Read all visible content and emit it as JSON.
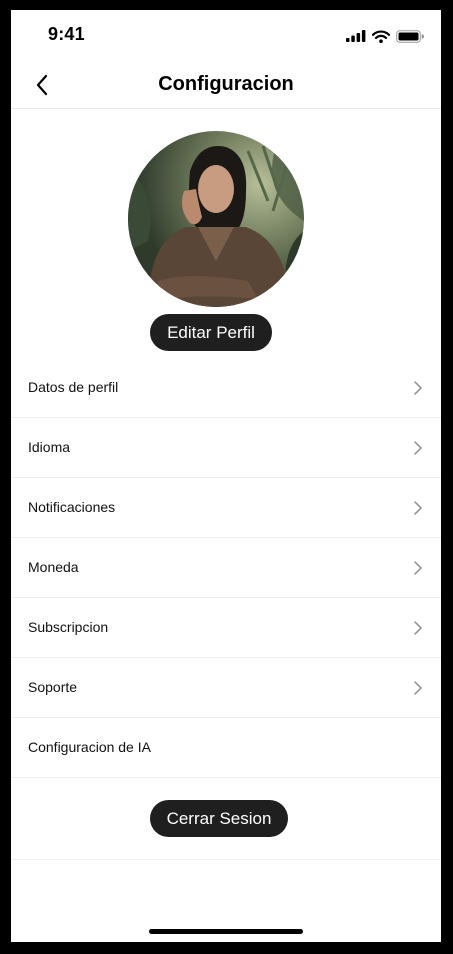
{
  "status_bar": {
    "time": "9:41"
  },
  "header": {
    "title": "Configuracion"
  },
  "profile": {
    "edit_label": "Editar Perfil"
  },
  "menu": {
    "items": [
      {
        "label": "Datos de perfil"
      },
      {
        "label": "Idioma"
      },
      {
        "label": "Notificaciones"
      },
      {
        "label": "Moneda"
      },
      {
        "label": "Subscripcion"
      },
      {
        "label": "Soporte"
      },
      {
        "label": "Configuracion de IA"
      }
    ]
  },
  "logout": {
    "label": "Cerrar Sesion"
  },
  "icons": {
    "back": "chevron-left-icon",
    "item_arrow": "chevron-right-icon",
    "signal": "cellular-signal-icon",
    "wifi": "wifi-icon",
    "battery": "battery-icon"
  },
  "colors": {
    "pill_bg": "#1f1f1f",
    "divider": "#ededed"
  }
}
